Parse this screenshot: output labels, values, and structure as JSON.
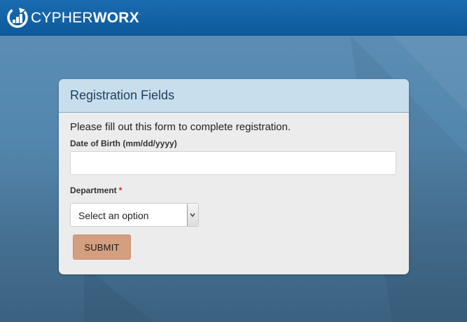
{
  "brand": {
    "name_light": "CYPHER",
    "name_bold": "WORX",
    "trademark": ".",
    "logo_icon": "cypherworx-circle-logo-icon"
  },
  "colors": {
    "header": "#1166aa",
    "background": "#5386ad",
    "card": "#ececed",
    "card_header": "#c8deed",
    "submit_button": "#d49f7f",
    "required_marker": "#dd2222"
  },
  "form": {
    "title": "Registration Fields",
    "intro": "Please fill out this form to complete registration.",
    "dob": {
      "label": "Date of Birth (mm/dd/yyyy)",
      "value": ""
    },
    "department": {
      "label": "Department",
      "required_marker": "*",
      "selected": "Select an option"
    },
    "submit_label": "SUBMIT"
  }
}
